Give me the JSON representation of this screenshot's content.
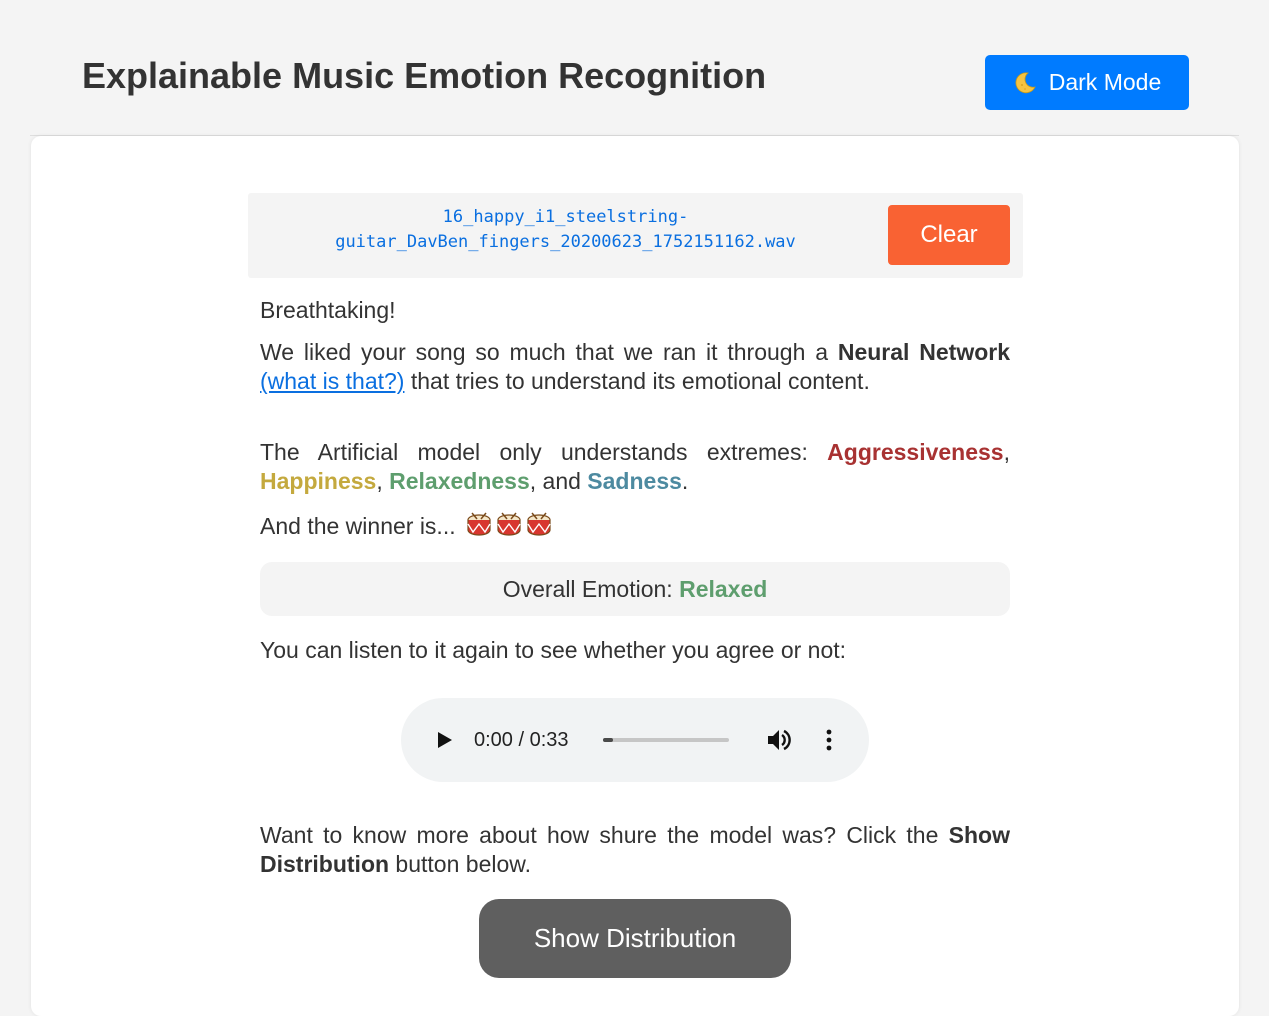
{
  "header": {
    "title": "Explainable Music Emotion Recognition",
    "dark_mode_label": "Dark Mode",
    "dark_mode_icon": "moon-icon",
    "dark_mode_color": "#007bff"
  },
  "file": {
    "name_line1": "16_happy_i1_steelstring-",
    "name_line2": "guitar_DavBen_fingers_20200623_1752151162.wav",
    "clear_label": "Clear",
    "clear_color": "#f96233"
  },
  "result": {
    "exclamation": "Breathtaking!",
    "intro_part1": "We liked your song so much that we ran it through a ",
    "intro_bold": "Neural Network",
    "intro_link": "(what is that?)",
    "intro_part2": " that tries to understand its emotional content.",
    "model_intro": "The Artificial model only understands extremes: ",
    "emotions": [
      {
        "label": "Aggressiveness",
        "color": "#a83232"
      },
      {
        "label": "Happiness",
        "color": "#c4a93e"
      },
      {
        "label": "Relaxedness",
        "color": "#5e9e6e"
      },
      {
        "label": "Sadness",
        "color": "#4d8aa0"
      }
    ],
    "sep_comma": ", ",
    "sep_and": ", and ",
    "period": ".",
    "winner_text": "And the winner is...",
    "winner_icon": "drum-icon",
    "overall_label": "Overall Emotion: ",
    "overall_value": "Relaxed",
    "overall_color": "#5e9e6e",
    "listen_text": "You can listen to it again to see whether you agree or not:"
  },
  "audio": {
    "time": "0:00 / 0:33",
    "progress_fraction": 0.0
  },
  "distribution": {
    "text_part1": "Want to know more about how shure the model was? Click the ",
    "text_bold": "Show Distribution",
    "text_part2": " button below.",
    "button_label": "Show Distribution"
  }
}
